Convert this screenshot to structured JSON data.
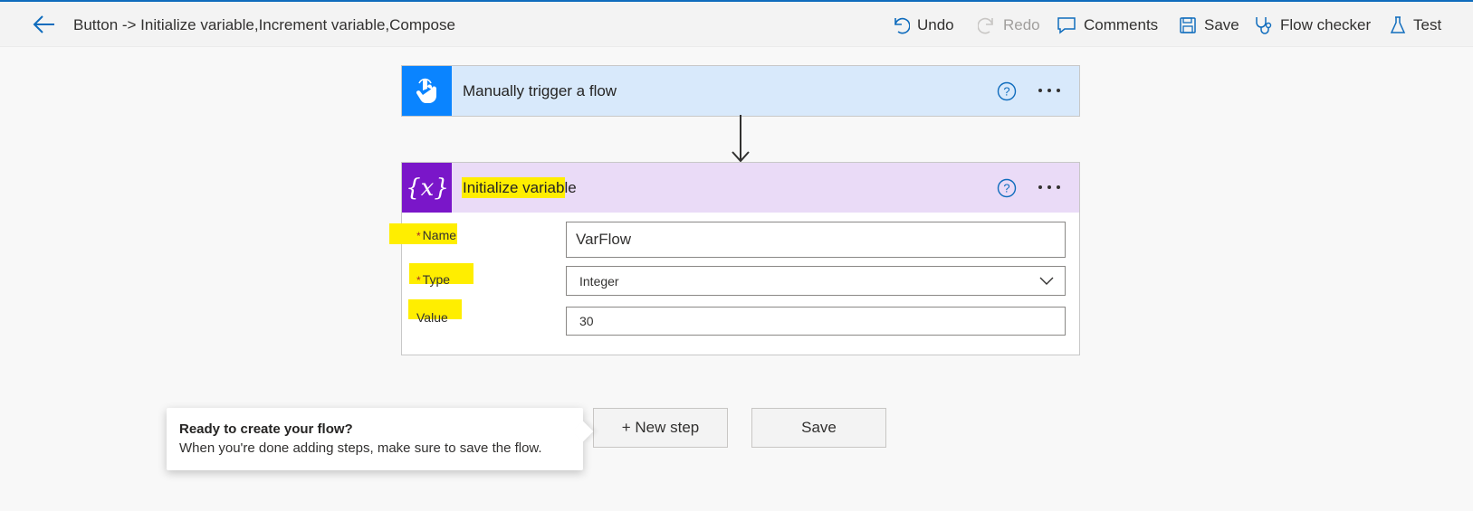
{
  "header": {
    "flow_title": "Button -> Initialize variable,Increment variable,Compose",
    "undo_label": "Undo",
    "redo_label": "Redo",
    "comments_label": "Comments",
    "save_label": "Save",
    "flow_checker_label": "Flow checker",
    "test_label": "Test"
  },
  "trigger_card": {
    "title": "Manually trigger a flow",
    "icon": "touch-hand-icon"
  },
  "init_card": {
    "title": "Initialize variable",
    "icon": "variable-braces-icon",
    "fields": {
      "name_label": "Name",
      "name_value": "VarFlow",
      "type_label": "Type",
      "type_value": "Integer",
      "value_label": "Value",
      "value_value": "30"
    }
  },
  "footer": {
    "new_step_label": "+ New step",
    "save_label": "Save"
  },
  "teaching_bubble": {
    "title": "Ready to create your flow?",
    "body": "When you're done adding steps, make sure to save the flow."
  },
  "colors": {
    "accent": "#0f6cbd",
    "trigger_icon_bg": "#0a84ff",
    "trigger_header_bg": "#d8e9fb",
    "variable_icon_bg": "#7a16c9",
    "variable_header_bg": "#eadbf7",
    "highlight": "#ffee00",
    "required_asterisk": "#a4262c"
  }
}
